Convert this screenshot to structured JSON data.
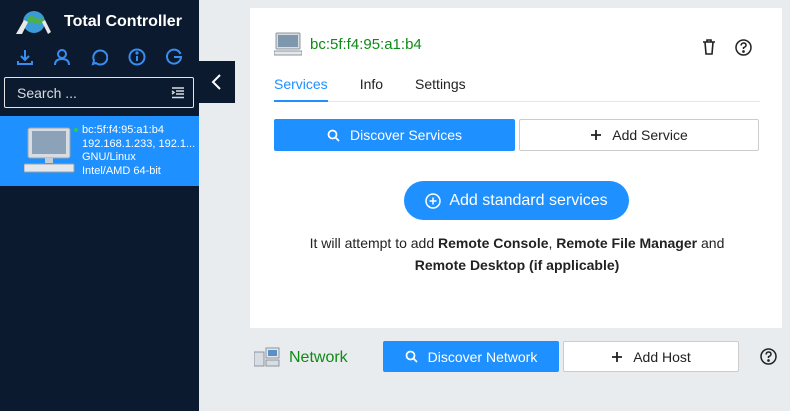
{
  "app": {
    "title": "Total Controller"
  },
  "toolbar": {
    "icons": [
      "download-icon",
      "user-icon",
      "whatsapp-icon",
      "info-icon",
      "google-icon"
    ]
  },
  "search": {
    "placeholder": "Search ...",
    "value": ""
  },
  "host": {
    "mac": "bc:5f:f4:95:a1:b4",
    "ips": "192.168.1.233, 192.1...",
    "os": "GNU/Linux",
    "arch": "Intel/AMD 64-bit",
    "status_color": "#2ecc40"
  },
  "detail": {
    "title": "bc:5f:f4:95:a1:b4",
    "tabs": [
      "Services",
      "Info",
      "Settings"
    ],
    "active_tab": "Services",
    "discover_services": "Discover Services",
    "add_service": "Add Service",
    "add_standard": "Add standard services",
    "desc": {
      "prefix": "It will attempt to add ",
      "item1": "Remote Console",
      "sep1": ", ",
      "item2": "Remote File Manager",
      "sep2": " and",
      "item3": "Remote Desktop (if applicable)"
    }
  },
  "network": {
    "label": "Network",
    "discover": "Discover Network",
    "add_host": "Add Host"
  },
  "colors": {
    "accent": "#1e90ff",
    "sidebar": "#0b1a2e",
    "green_title": "#0e8a16"
  }
}
